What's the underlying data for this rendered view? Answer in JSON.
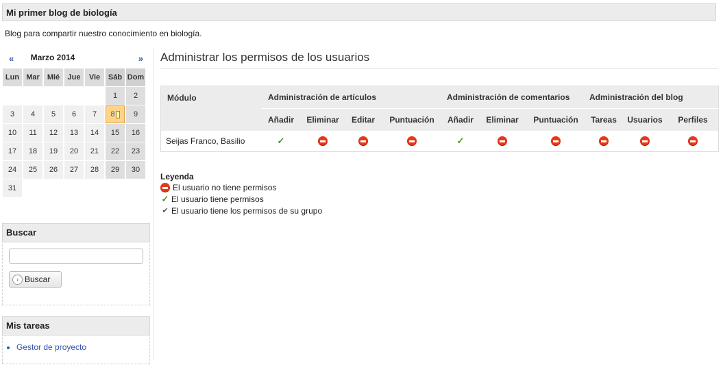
{
  "header": {
    "blog_title": "Mi primer blog de biología",
    "description": "Blog para compartir nuestro conocimiento en biología."
  },
  "calendar": {
    "prev": "«",
    "next": "»",
    "month": "Marzo 2014",
    "weekdays": [
      "Lun",
      "Mar",
      "Mié",
      "Jue",
      "Vie",
      "Sáb",
      "Dom"
    ],
    "leading_blanks": 5,
    "days": [
      "1",
      "2",
      "3",
      "4",
      "5",
      "6",
      "7",
      "8",
      "9",
      "10",
      "11",
      "12",
      "13",
      "14",
      "15",
      "16",
      "17",
      "18",
      "19",
      "20",
      "21",
      "22",
      "23",
      "24",
      "25",
      "26",
      "27",
      "28",
      "29",
      "30",
      "31"
    ],
    "today": "8"
  },
  "search": {
    "title": "Buscar",
    "placeholder": "",
    "button": "Buscar"
  },
  "tasks": {
    "title": "Mis tareas",
    "items": [
      "Gestor de proyecto"
    ]
  },
  "main": {
    "title": "Administrar los permisos de los usuarios",
    "table": {
      "module_header": "Módulo",
      "groups": [
        {
          "label": "Administración de artículos",
          "columns": [
            "Añadir",
            "Eliminar",
            "Editar",
            "Puntuación"
          ]
        },
        {
          "label": "Administración de comentarios",
          "columns": [
            "Añadir",
            "Eliminar",
            "Puntuación"
          ]
        },
        {
          "label": "Administración del blog",
          "columns": [
            "Tareas",
            "Usuarios",
            "Perfiles"
          ]
        }
      ],
      "rows": [
        {
          "user": "Seijas Franco, Basilio",
          "perms": [
            "allow",
            "deny",
            "deny",
            "deny",
            "allow",
            "deny",
            "deny",
            "deny",
            "deny",
            "deny"
          ]
        }
      ]
    },
    "legend": {
      "title": "Leyenda",
      "items": [
        {
          "icon": "deny-icon",
          "text": "El usuario no tiene permisos"
        },
        {
          "icon": "allow-icon",
          "text": "El usuario tiene permisos"
        },
        {
          "icon": "group-allow-icon",
          "text": "El usuario tiene los permisos de su grupo"
        }
      ]
    }
  }
}
